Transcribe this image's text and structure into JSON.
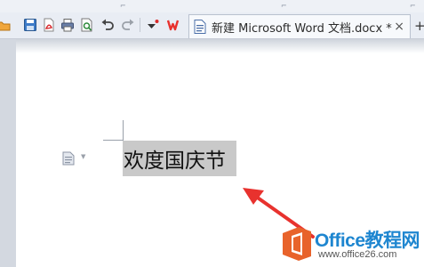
{
  "tab": {
    "label": "新建 Microsoft Word 文档.docx *",
    "close_glyph": "×",
    "add_glyph": "+"
  },
  "document": {
    "selected_text": "欢度国庆节"
  },
  "watermark": {
    "brand": "Office教程网",
    "url": "www.office26.com"
  },
  "toolbar": {
    "icons": [
      "open-icon",
      "save-icon",
      "export-pdf-icon",
      "print-icon",
      "print-preview-icon",
      "undo-icon",
      "redo-icon",
      "customize-dropdown-icon",
      "wps-logo-icon"
    ]
  },
  "colors": {
    "selection": "#c9c9c9",
    "annotation_arrow": "#e8322e",
    "watermark_brand": "#1e86d0",
    "wps_logo": "#e8322e"
  }
}
